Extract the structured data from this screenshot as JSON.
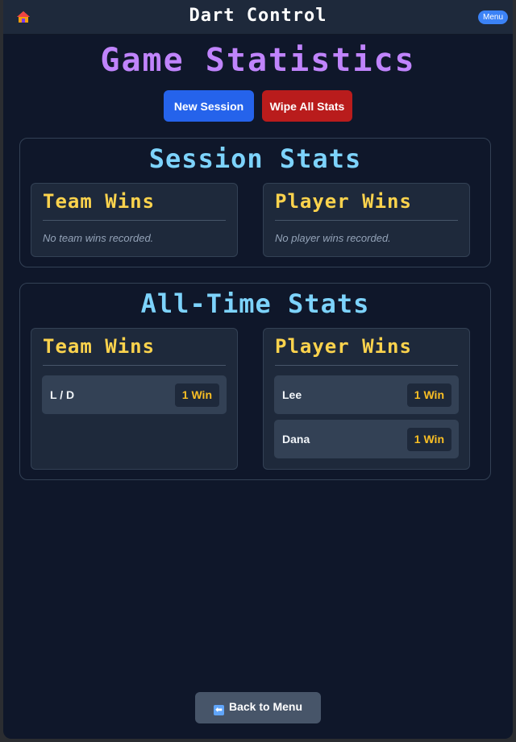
{
  "header": {
    "home_icon": "house-icon",
    "title": "Dart Control",
    "menu_label": "Menu"
  },
  "page": {
    "title": "Game Statistics"
  },
  "actions": {
    "new_session": "New Session",
    "wipe_all": "Wipe All Stats"
  },
  "session": {
    "title": "Session Stats",
    "team": {
      "title": "Team Wins",
      "empty": "No team wins recorded."
    },
    "player": {
      "title": "Player Wins",
      "empty": "No player wins recorded."
    }
  },
  "alltime": {
    "title": "All-Time Stats",
    "team": {
      "title": "Team Wins",
      "rows": [
        {
          "name": "L / D",
          "wins": "1 Win"
        }
      ]
    },
    "player": {
      "title": "Player Wins",
      "rows": [
        {
          "name": "Lee",
          "wins": "1 Win"
        },
        {
          "name": "Dana",
          "wins": "1 Win"
        }
      ]
    }
  },
  "footer": {
    "back_icon": "back-arrow-icon",
    "back_label": "Back to Menu"
  },
  "colors": {
    "background": "#0f172a",
    "accent_purple": "#c084fc",
    "accent_cyan": "#7dd3fc",
    "accent_yellow": "#fcd34d",
    "primary_blue": "#2563eb",
    "danger_red": "#b91c1c"
  }
}
